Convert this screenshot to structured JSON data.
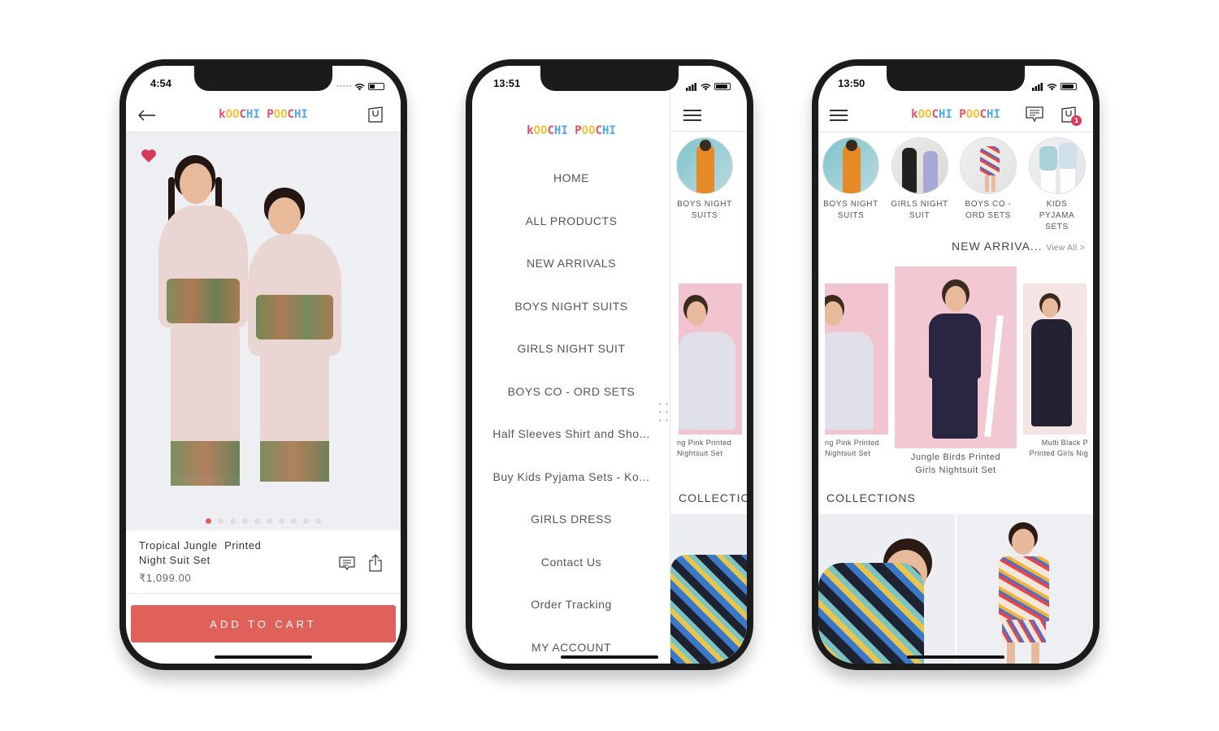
{
  "brand": {
    "logo_letters": [
      {
        "ch": "k",
        "c": "lr"
      },
      {
        "ch": "O",
        "c": "ly"
      },
      {
        "ch": "O",
        "c": "ly"
      },
      {
        "ch": "C",
        "c": "lr"
      },
      {
        "ch": "H",
        "c": "lb"
      },
      {
        "ch": "I",
        "c": "lb"
      },
      {
        "ch": " ",
        "c": "lr"
      },
      {
        "ch": "P",
        "c": "lr"
      },
      {
        "ch": "O",
        "c": "ly"
      },
      {
        "ch": "O",
        "c": "ly"
      },
      {
        "ch": "C",
        "c": "lr"
      },
      {
        "ch": "H",
        "c": "lb"
      },
      {
        "ch": "I",
        "c": "lb"
      }
    ],
    "logo_text": "KOOCHI POOCHI",
    "colors": {
      "accent_red": "#e0605a",
      "heart": "#d93a5b",
      "logo_red": "#e25169",
      "logo_yellow": "#f1c232",
      "logo_blue": "#4ea8e8",
      "badge": "#d93a5b"
    }
  },
  "phone1": {
    "status_time": "4:54",
    "header": {
      "back_icon": "arrow-left-icon",
      "cart_icon": "shopping-bag-icon"
    },
    "favorite_icon": "heart-icon",
    "carousel": {
      "total": 10,
      "active": 1
    },
    "product": {
      "title_line1": "Tropical Jungle  Printed",
      "title_line2": "Night Suit Set",
      "price": "₹1,099.00",
      "chat_icon": "chat-icon",
      "share_icon": "share-icon"
    },
    "add_to_cart": "ADD TO CART"
  },
  "phone2": {
    "status_time": "13:51",
    "menu": [
      "HOME",
      "ALL PRODUCTS",
      "NEW ARRIVALS",
      "BOYS NIGHT SUITS",
      "GIRLS NIGHT SUIT",
      "BOYS CO - ORD SETS",
      "Half Sleeves Shirt and Sho...",
      "Buy Kids Pyjama Sets -  Ko...",
      "GIRLS DRESS",
      "Contact Us",
      "Order Tracking",
      "MY ACCOUNT"
    ],
    "peek": {
      "category_line1": "BOYS NIGHT",
      "category_line2": "SUITS",
      "product_line1": "ng Pink Printed",
      "product_line2": "Nightsuit Set",
      "collections": "COLLECTIC"
    }
  },
  "phone3": {
    "status_time": "13:50",
    "cart_badge": "1",
    "categories": [
      {
        "line1": "BOYS NIGHT",
        "line2": "SUITS"
      },
      {
        "line1": "GIRLS NIGHT",
        "line2": "SUIT"
      },
      {
        "line1": "BOYS CO -",
        "line2": "ORD SETS"
      },
      {
        "line1": "KIDS PYJAMA",
        "line2": "SETS"
      }
    ],
    "new_arrivals": {
      "title": "NEW ARRIVA...",
      "view_all": "View All >",
      "items": [
        {
          "line1": "ng Pink Printed",
          "line2": "Nightsuit Set"
        },
        {
          "line1": "Jungle Birds Printed",
          "line2": "Girls Nightsuit Set"
        },
        {
          "line1": "Multi Black P",
          "line2": "Printed Girls Nig"
        }
      ]
    },
    "collections_title": "COLLECTIONS"
  }
}
